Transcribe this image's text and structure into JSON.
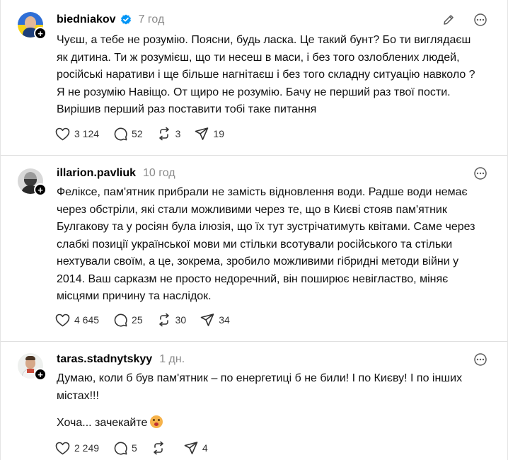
{
  "posts": [
    {
      "username": "biedniakov",
      "verified": true,
      "time": "7 год",
      "paragraphs": [
        "Чуєш, а тебе не розумію. Поясни, будь ласка. Це такий бунт? Бо ти виглядаєш як дитина. Ти ж розумієш, що ти несеш в маси, і без того озлоблених людей, російські наративи і ще більше нагнітаєш і без того складну ситуацію навколо ? Я не розумію Навіщо. От щиро не розумію. Бачу не перший раз твої пости. Вирішив перший раз поставити тобі таке питання"
      ],
      "likes": "3 124",
      "replies": "52",
      "reposts": "3",
      "shares": "19"
    },
    {
      "username": "illarion.pavliuk",
      "verified": false,
      "time": "10 год",
      "paragraphs": [
        "Феліксе, пам'ятник прибрали не замість відновлення води. Радше води немає через обстріли, які стали можливими через те, що в Києві стояв пам'ятник Булгакову та у росіян була ілюзія, що їх тут зустрічатимуть квітами. Саме через слабкі позиції української мови ми стільки всотували російського та стільки нехтували своїм, а це, зокрема, зробило можливими гібридні методи війни у 2014. Ваш сарказм не просто недоречний, він поширює невігластво, міняє місцями причину та наслідок."
      ],
      "likes": "4 645",
      "replies": "25",
      "reposts": "30",
      "shares": "34"
    },
    {
      "username": "taras.stadnytskyy",
      "verified": false,
      "time": "1 дн.",
      "paragraphs": [
        "Думаю, коли б був пам'ятник – по енергетиці б не били! І по Києву! І по інших містах!!!",
        "Хоча... зачекайте"
      ],
      "likes": "2 249",
      "replies": "5",
      "reposts": "",
      "shares": "4"
    }
  ],
  "icons": {
    "like": "heart-icon",
    "reply": "comment-icon",
    "repost": "repost-icon",
    "share": "share-icon",
    "edit": "pencil-icon",
    "more": "more-icon",
    "follow": "plus-icon"
  },
  "colors": {
    "verified": "#0095f6",
    "muted": "#8a8a8a"
  }
}
